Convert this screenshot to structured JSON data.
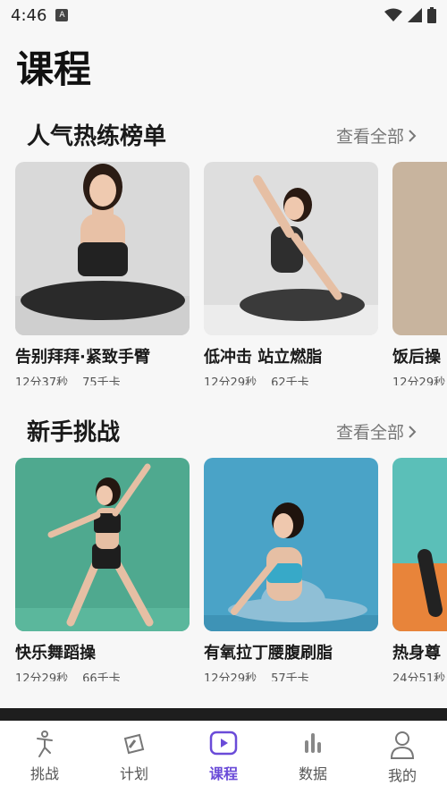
{
  "status": {
    "time": "4:46",
    "app_icon": "A"
  },
  "page_title": "课程",
  "sections": [
    {
      "title": "人气热练榜单",
      "more": "查看全部",
      "cards": [
        {
          "title": "告别拜拜·紧致手臂",
          "duration": "12分37秒",
          "calories": "75千卡"
        },
        {
          "title": "低冲击 站立燃脂",
          "duration": "12分29秒",
          "calories": "62千卡"
        },
        {
          "title": "饭后操",
          "duration": "12分29秒",
          "calories": ""
        }
      ]
    },
    {
      "title": "新手挑战",
      "more": "查看全部",
      "cards": [
        {
          "title": "快乐舞蹈操",
          "duration": "12分29秒",
          "calories": "66千卡"
        },
        {
          "title": "有氧拉丁腰腹刷脂",
          "duration": "12分29秒",
          "calories": "57千卡"
        },
        {
          "title": "热身尊",
          "duration": "24分51秒",
          "calories": ""
        }
      ]
    }
  ],
  "tabs": [
    {
      "label": "挑战",
      "icon": "challenge-icon"
    },
    {
      "label": "计划",
      "icon": "plan-icon"
    },
    {
      "label": "课程",
      "icon": "course-play-icon",
      "active": true
    },
    {
      "label": "数据",
      "icon": "data-bars-icon"
    },
    {
      "label": "我的",
      "icon": "profile-icon"
    }
  ],
  "colors": {
    "accent": "#6a4bd8",
    "text": "#1a1a1a",
    "muted": "#777777"
  }
}
